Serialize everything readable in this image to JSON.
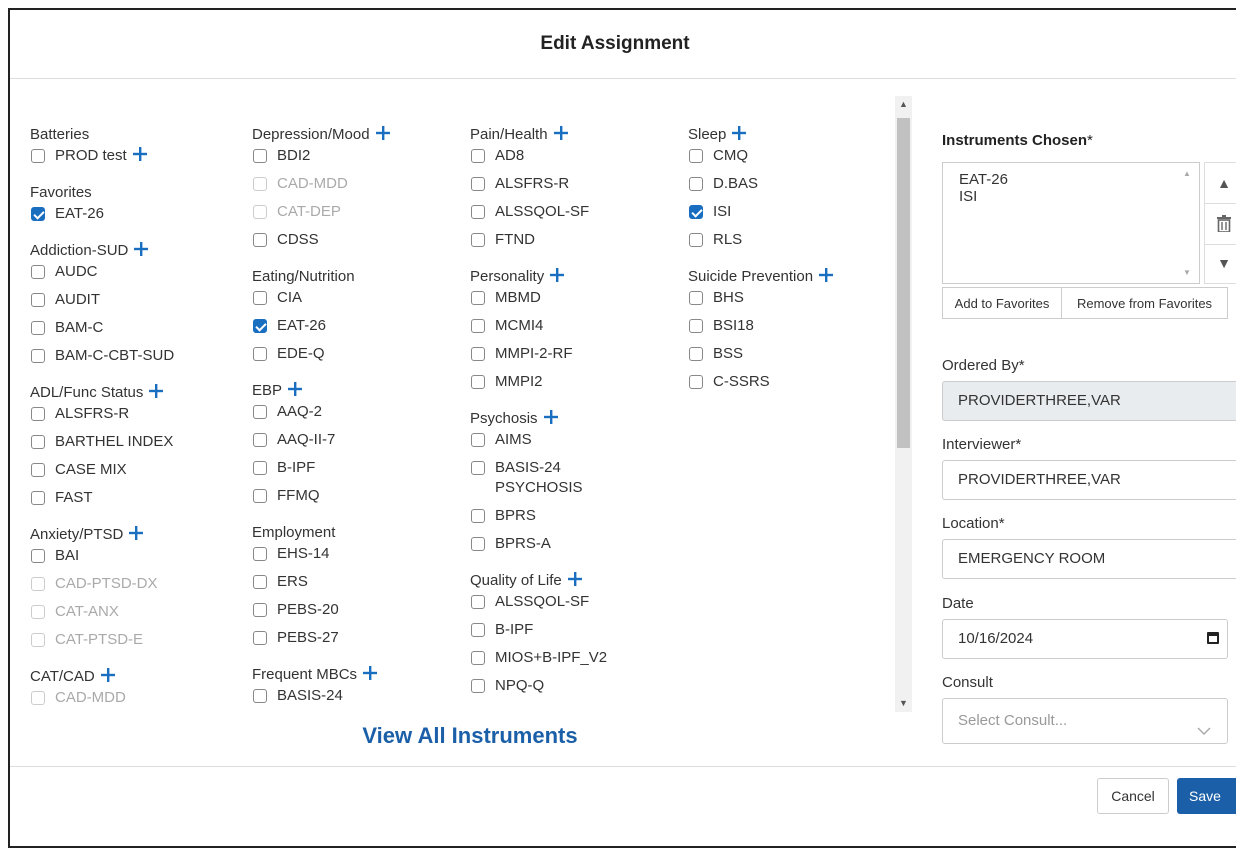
{
  "modal": {
    "title": "Edit Assignment"
  },
  "columns": [
    [
      {
        "name": "Batteries",
        "plus": false,
        "items": [
          {
            "label": "PROD test",
            "plus": true
          }
        ]
      },
      {
        "name": "Favorites",
        "plus": false,
        "items": [
          {
            "label": "EAT-26",
            "checked": true
          }
        ]
      },
      {
        "name": "Addiction-SUD",
        "plus": true,
        "items": [
          {
            "label": "AUDC"
          },
          {
            "label": "AUDIT"
          },
          {
            "label": "BAM-C"
          },
          {
            "label": "BAM-C-CBT-SUD"
          }
        ]
      },
      {
        "name": "ADL/Func Status",
        "plus": true,
        "items": [
          {
            "label": "ALSFRS-R"
          },
          {
            "label": "BARTHEL INDEX"
          },
          {
            "label": "CASE MIX"
          },
          {
            "label": "FAST"
          }
        ]
      },
      {
        "name": "Anxiety/PTSD",
        "plus": true,
        "items": [
          {
            "label": "BAI"
          },
          {
            "label": "CAD-PTSD-DX",
            "disabled": true
          },
          {
            "label": "CAT-ANX",
            "disabled": true
          },
          {
            "label": "CAT-PTSD-E",
            "disabled": true
          }
        ]
      },
      {
        "name": "CAT/CAD",
        "plus": true,
        "items": [
          {
            "label": "CAD-MDD",
            "disabled": true
          }
        ]
      }
    ],
    [
      {
        "name": "Depression/Mood",
        "plus": true,
        "items": [
          {
            "label": "BDI2"
          },
          {
            "label": "CAD-MDD",
            "disabled": true
          },
          {
            "label": "CAT-DEP",
            "disabled": true
          },
          {
            "label": "CDSS"
          }
        ]
      },
      {
        "name": "Eating/Nutrition",
        "plus": false,
        "items": [
          {
            "label": "CIA"
          },
          {
            "label": "EAT-26",
            "checked": true
          },
          {
            "label": "EDE-Q"
          }
        ]
      },
      {
        "name": "EBP",
        "plus": true,
        "items": [
          {
            "label": "AAQ-2"
          },
          {
            "label": "AAQ-II-7"
          },
          {
            "label": "B-IPF"
          },
          {
            "label": "FFMQ"
          }
        ]
      },
      {
        "name": "Employment",
        "plus": false,
        "items": [
          {
            "label": "EHS-14"
          },
          {
            "label": "ERS"
          },
          {
            "label": "PEBS-20"
          },
          {
            "label": "PEBS-27"
          }
        ]
      },
      {
        "name": "Frequent MBCs",
        "plus": true,
        "items": [
          {
            "label": "BASIS-24"
          }
        ]
      }
    ],
    [
      {
        "name": "Pain/Health",
        "plus": true,
        "items": [
          {
            "label": "AD8"
          },
          {
            "label": "ALSFRS-R"
          },
          {
            "label": "ALSSQOL-SF"
          },
          {
            "label": "FTND"
          }
        ]
      },
      {
        "name": "Personality",
        "plus": true,
        "items": [
          {
            "label": "MBMD"
          },
          {
            "label": "MCMI4"
          },
          {
            "label": "MMPI-2-RF"
          },
          {
            "label": "MMPI2"
          }
        ]
      },
      {
        "name": "Psychosis",
        "plus": true,
        "items": [
          {
            "label": "AIMS"
          },
          {
            "label": "BASIS-24 PSYCHOSIS",
            "tall": true
          },
          {
            "label": "BPRS"
          },
          {
            "label": "BPRS-A"
          }
        ]
      },
      {
        "name": "Quality of Life",
        "plus": true,
        "items": [
          {
            "label": "ALSSQOL-SF"
          },
          {
            "label": "B-IPF"
          },
          {
            "label": "MIOS+B-IPF_V2"
          },
          {
            "label": "NPQ-Q"
          }
        ]
      }
    ],
    [
      {
        "name": "Sleep",
        "plus": true,
        "items": [
          {
            "label": "CMQ"
          },
          {
            "label": "D.BAS"
          },
          {
            "label": "ISI",
            "checked": true
          },
          {
            "label": "RLS"
          }
        ]
      },
      {
        "name": "Suicide Prevention",
        "plus": true,
        "items": [
          {
            "label": "BHS"
          },
          {
            "label": "BSI18"
          },
          {
            "label": "BSS"
          },
          {
            "label": "C-SSRS"
          }
        ]
      }
    ]
  ],
  "view_all": "View All Instruments",
  "chosen": {
    "label": "Instruments Chosen",
    "required": "*",
    "items": [
      "EAT-26",
      "ISI"
    ],
    "add_fav": "Add to Favorites",
    "remove_fav": "Remove from Favorites"
  },
  "form": {
    "ordered_by_label": "Ordered By*",
    "ordered_by_value": "PROVIDERTHREE,VAR",
    "interviewer_label": "Interviewer*",
    "interviewer_value": "PROVIDERTHREE,VAR",
    "location_label": "Location*",
    "location_value": "EMERGENCY ROOM",
    "date_label": "Date",
    "date_value": "10/16/2024",
    "consult_label": "Consult",
    "consult_placeholder": "Select Consult..."
  },
  "footer": {
    "cancel": "Cancel",
    "save": "Save"
  },
  "icons": {
    "plus": "plus-icon",
    "trash": "trash-icon",
    "calendar": "calendar-icon",
    "chevron": "chevron-down-icon"
  },
  "colors": {
    "accent": "#1a6ec0",
    "save_bg": "#1a5fa8",
    "link": "#1a5fa8"
  }
}
